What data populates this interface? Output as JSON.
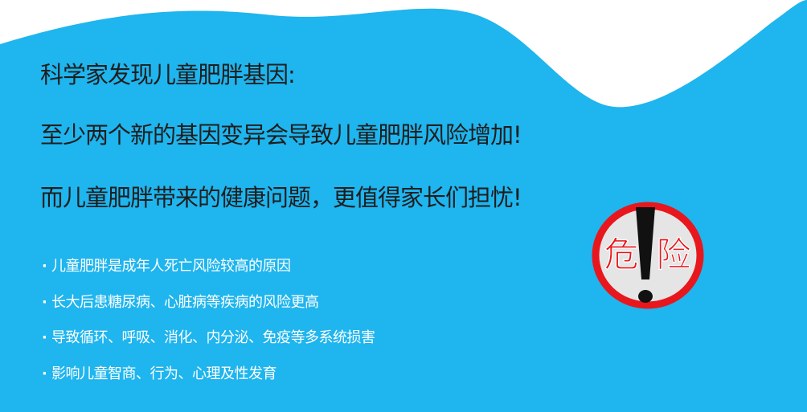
{
  "headlines": {
    "line1": "科学家发现儿童肥胖基因:",
    "line2": "至少两个新的基因变异会导致儿童肥胖风险增加!",
    "line3": "而儿童肥胖带来的健康问题，更值得家长们担忧!"
  },
  "bullets": {
    "marker": "·",
    "items": [
      "儿童肥胖是成年人死亡风险较高的原因",
      "长大后患糖尿病、心脏病等疾病的风险更高",
      "导致循环、呼吸、消化、内分泌、免疫等多系统损害",
      "影响儿童智商、行为、心理及性发育"
    ]
  },
  "danger_sign": {
    "text1": "危",
    "text2": "险",
    "icon": "exclamation-warning-icon"
  },
  "colors": {
    "background_blue": "#1fb5ee",
    "danger_red": "#e8171d",
    "headline_text": "#1e1e1e",
    "bullet_text": "#ffffff"
  }
}
